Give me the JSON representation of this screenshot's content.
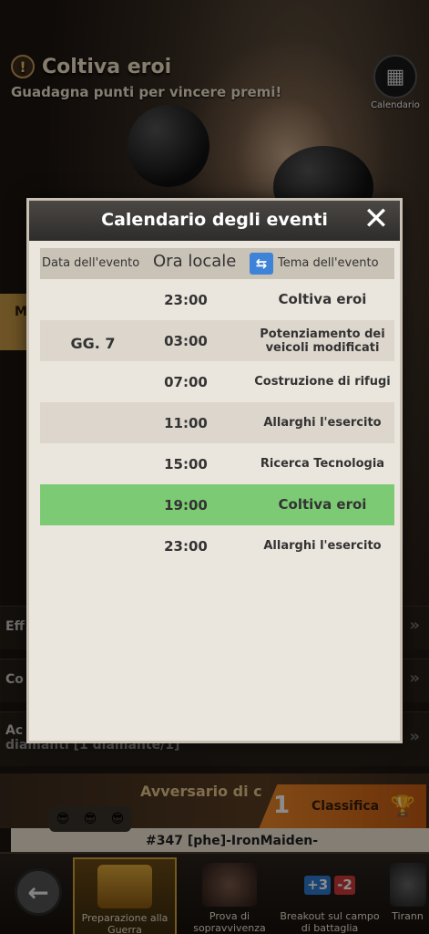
{
  "header": {
    "title": "Coltiva eroi",
    "subtitle": "Guadagna punti per vincere premi!",
    "calendar_label": "Calendario"
  },
  "background_rows": [
    {
      "label": "Eff"
    },
    {
      "label": "Co"
    },
    {
      "label": "Ac"
    },
    {
      "label": "diamanti [1 diamante/1]"
    }
  ],
  "left_tab": "M",
  "adversary": {
    "label": "Avversario di c",
    "rank_number": "1",
    "rank_label": "Classifica",
    "opponent_name": "#347 [phe]-IronMaiden-"
  },
  "nav": {
    "items": [
      {
        "label": "Preparazione alla Guerra",
        "active": true
      },
      {
        "label": "Prova di sopravvivenza",
        "active": false
      },
      {
        "label": "Breakout sul campo di battaglia",
        "active": false
      },
      {
        "label": "Tirann",
        "active": false
      }
    ],
    "breakout_badges": [
      "+3",
      "-2"
    ]
  },
  "modal": {
    "title": "Calendario degli eventi",
    "columns": {
      "date": "Data dell'evento",
      "time": "Ora locale",
      "theme": "Tema dell'evento"
    },
    "day_label": "GG. 7",
    "rows": [
      {
        "time": "23:00",
        "theme": "Coltiva eroi",
        "highlight": false
      },
      {
        "time": "03:00",
        "theme": "Potenziamento dei veicoli modificati",
        "highlight": false
      },
      {
        "time": "07:00",
        "theme": "Costruzione di rifugi",
        "highlight": false
      },
      {
        "time": "11:00",
        "theme": "Allarghi l'esercito",
        "highlight": false
      },
      {
        "time": "15:00",
        "theme": "Ricerca Tecnologia",
        "highlight": false
      },
      {
        "time": "19:00",
        "theme": "Coltiva eroi",
        "highlight": true
      },
      {
        "time": "23:00",
        "theme": "Allarghi l'esercito",
        "highlight": false
      }
    ]
  },
  "colors": {
    "highlight_row": "#7ccb74",
    "rank_orange": "#f08a2a",
    "swap_button": "#3d84d8"
  }
}
